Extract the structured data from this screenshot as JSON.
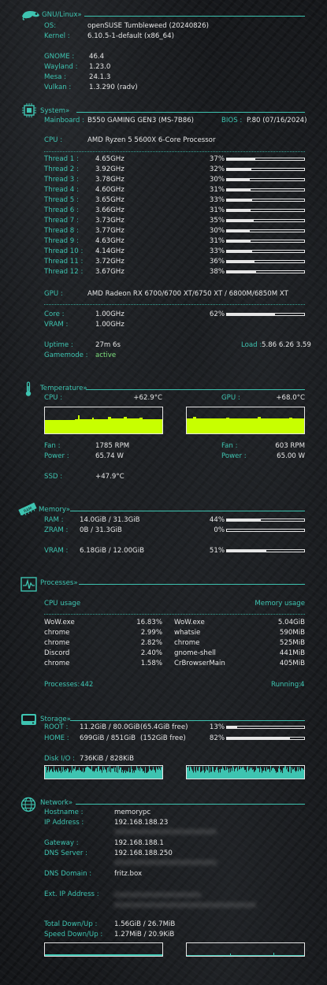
{
  "colors": {
    "accent": "#3ec4b1",
    "text": "#e6e6e6",
    "temp_graph": "#c8ff00",
    "disk_graph": "#3ec4b1",
    "active": "#7ee07e"
  },
  "icons": {
    "gnu": "chameleon-icon",
    "system": "cpu-chip-icon",
    "temp": "thermometer-icon",
    "memory": "ram-icon",
    "processes": "activity-monitor-icon",
    "storage": "hard-drive-icon",
    "network": "globe-icon"
  },
  "gnu": {
    "title": "GNU/Linux»",
    "os_label": "OS:",
    "os": "openSUSE Tumbleweed (20240826)",
    "kernel_label": "Kernel :",
    "kernel": "6.10.5-1-default (x86_64)",
    "gnome_label": "GNOME :",
    "gnome": "46.4",
    "wayland_label": "Wayland :",
    "wayland": "1.23.0",
    "mesa_label": "Mesa :",
    "mesa": "24.1.3",
    "vulkan_label": "Vulkan :",
    "vulkan": "1.3.290 (radv)"
  },
  "system": {
    "title": "System»",
    "mainboard_label": "Mainboard :",
    "mainboard": "B550 GAMING GEN3 (MS-7B86)",
    "bios_label": "BIOS :",
    "bios": "P.80 (07/16/2024)",
    "cpu_label": "CPU :",
    "cpu": "AMD Ryzen 5 5600X 6-Core Processor",
    "threads": [
      {
        "label": "Thread 1 :",
        "freq": "4.65GHz",
        "pct": "37%",
        "v": 37
      },
      {
        "label": "Thread 2 :",
        "freq": "3.92GHz",
        "pct": "32%",
        "v": 32
      },
      {
        "label": "Thread 3 :",
        "freq": "3.78GHz",
        "pct": "30%",
        "v": 30
      },
      {
        "label": "Thread 4 :",
        "freq": "4.60GHz",
        "pct": "31%",
        "v": 31
      },
      {
        "label": "Thread 5 :",
        "freq": "3.65GHz",
        "pct": "33%",
        "v": 33
      },
      {
        "label": "Thread 6 :",
        "freq": "3.66GHz",
        "pct": "31%",
        "v": 31
      },
      {
        "label": "Thread 7 :",
        "freq": "3.73GHz",
        "pct": "35%",
        "v": 35
      },
      {
        "label": "Thread 8 :",
        "freq": "3.77GHz",
        "pct": "30%",
        "v": 30
      },
      {
        "label": "Thread 9 :",
        "freq": "4.63GHz",
        "pct": "31%",
        "v": 31
      },
      {
        "label": "Thread 10 :",
        "freq": "4.14GHz",
        "pct": "33%",
        "v": 33
      },
      {
        "label": "Thread 11 :",
        "freq": "3.72GHz",
        "pct": "36%",
        "v": 36
      },
      {
        "label": "Thread 12 :",
        "freq": "3.67GHz",
        "pct": "38%",
        "v": 38
      }
    ],
    "gpu_label": "GPU :",
    "gpu": "AMD Radeon RX 6700/6700 XT/6750 XT / 6800M/6850M XT",
    "core_label": "Core :",
    "core": "1.00GHz",
    "core_pct": "62%",
    "core_v": 62,
    "vram_label": "VRAM :",
    "vram": "1.00GHz",
    "uptime_label": "Uptime :",
    "uptime": "27m 6s",
    "load_label": "Load :",
    "load": "5.86 6.26 3.59",
    "gamemode_label": "Gamemode :",
    "gamemode": "active"
  },
  "temp": {
    "title": "Temperature»",
    "cpu_label": "CPU :",
    "cpu": "+62.9°C",
    "gpu_label": "GPU :",
    "gpu": "+68.0°C",
    "fan_label": "Fan :",
    "cpu_fan": "1785 RPM",
    "gpu_fan": "603 RPM",
    "power_label": "Power :",
    "cpu_power": "65.74 W",
    "gpu_power": "65.00 W",
    "ssd_label": "SSD :",
    "ssd": "+47.9°C"
  },
  "memory": {
    "title": "Memory»",
    "ram_label": "RAM :",
    "ram": "14.0GiB / 31.3GiB",
    "ram_pct": "44%",
    "ram_v": 44,
    "zram_label": "ZRAM :",
    "zram": "0B / 31.3GiB",
    "zram_pct": "0%",
    "zram_v": 0,
    "vram_label": "VRAM :",
    "vram": "6.18GiB / 12.00GiB",
    "vram_pct": "51%",
    "vram_v": 51
  },
  "processes": {
    "title": "Processes»",
    "cpu_usage": "CPU usage",
    "mem_usage": "Memory usage",
    "cpu_list": [
      {
        "name": "WoW.exe",
        "v": "16.83%"
      },
      {
        "name": "chrome",
        "v": "2.99%"
      },
      {
        "name": "chrome",
        "v": "2.82%"
      },
      {
        "name": "Discord",
        "v": "2.40%"
      },
      {
        "name": "chrome",
        "v": "1.58%"
      }
    ],
    "mem_list": [
      {
        "name": "WoW.exe",
        "v": "5.04GiB"
      },
      {
        "name": "whatsie",
        "v": "590MiB"
      },
      {
        "name": "chrome",
        "v": "525MiB"
      },
      {
        "name": "gnome-shell",
        "v": "441MiB"
      },
      {
        "name": "CrBrowserMain",
        "v": "405MiB"
      }
    ],
    "processes_label": "Processes:",
    "processes": "442",
    "running_label": "Running:",
    "running": "4"
  },
  "storage": {
    "title": "Storage»",
    "root_label": "ROOT :",
    "root": "11.2GiB / 80.0GiB",
    "root_free": "(65.4GiB free)",
    "root_pct": "13%",
    "root_v": 13,
    "home_label": "HOME :",
    "home": "699GiB / 851GiB",
    "home_free": "(152GiB free)",
    "home_pct": "82%",
    "home_v": 82,
    "diskio_label": "Disk I/O :",
    "diskio": "736KiB / 828KiB"
  },
  "network": {
    "title": "Network»",
    "hostname_label": "Hostname :",
    "hostname": "memorypc",
    "ip_label": "IP Address :",
    "ip": "192.168.188.23",
    "gateway_label": "Gateway :",
    "gateway": "192.168.188.1",
    "dns_label": "DNS Server :",
    "dns": "192.168.188.250",
    "domain_label": "DNS Domain :",
    "domain": "fritz.box",
    "extip_label": "Ext. IP Address :",
    "total_label": "Total Down/Up :",
    "total": "1.56GiB / 26.7MiB",
    "speed_label": "Speed Down/Up :",
    "speed": "1.27MiB / 20.9KiB"
  }
}
